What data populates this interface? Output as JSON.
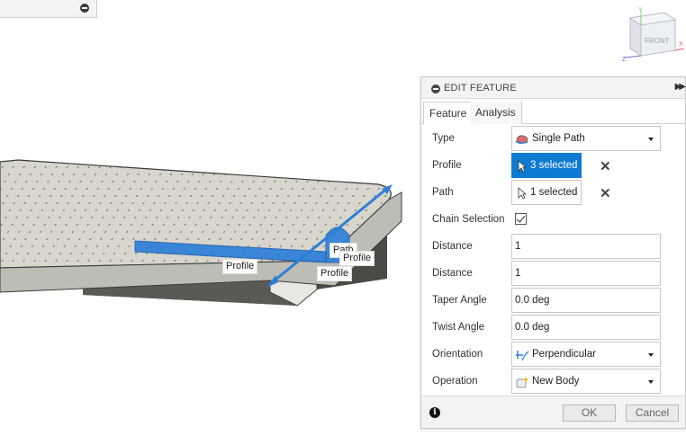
{
  "viewcube": {
    "face_label": "FRONT",
    "axis_x": "X",
    "axis_y": "Y",
    "axis_z": "Z"
  },
  "viewport_labels": {
    "profile_1": "Profile",
    "path": "Path",
    "profile_2": "Profile",
    "profile_3": "Profile"
  },
  "panel": {
    "title": "EDIT FEATURE",
    "tabs": [
      {
        "label": "Feature"
      },
      {
        "label": "Analysis"
      }
    ],
    "rows": {
      "type": {
        "label": "Type",
        "value": "Single Path"
      },
      "profile": {
        "label": "Profile",
        "value": "3 selected"
      },
      "path": {
        "label": "Path",
        "value": "1 selected"
      },
      "chain_selection": {
        "label": "Chain Selection",
        "checked": true
      },
      "distance1": {
        "label": "Distance",
        "value": "1"
      },
      "distance2": {
        "label": "Distance",
        "value": "1"
      },
      "taper_angle": {
        "label": "Taper Angle",
        "value": "0.0 deg"
      },
      "twist_angle": {
        "label": "Twist Angle",
        "value": "0.0 deg"
      },
      "orientation": {
        "label": "Orientation",
        "value": "Perpendicular"
      },
      "operation": {
        "label": "Operation",
        "value": "New Body"
      }
    },
    "ok_label": "OK",
    "cancel_label": "Cancel",
    "info_glyph": "i"
  },
  "colors": {
    "accent": "#0f7ad3",
    "selection": "#2d7fd8",
    "plate": "#d8d6cc",
    "base": "#595954"
  }
}
